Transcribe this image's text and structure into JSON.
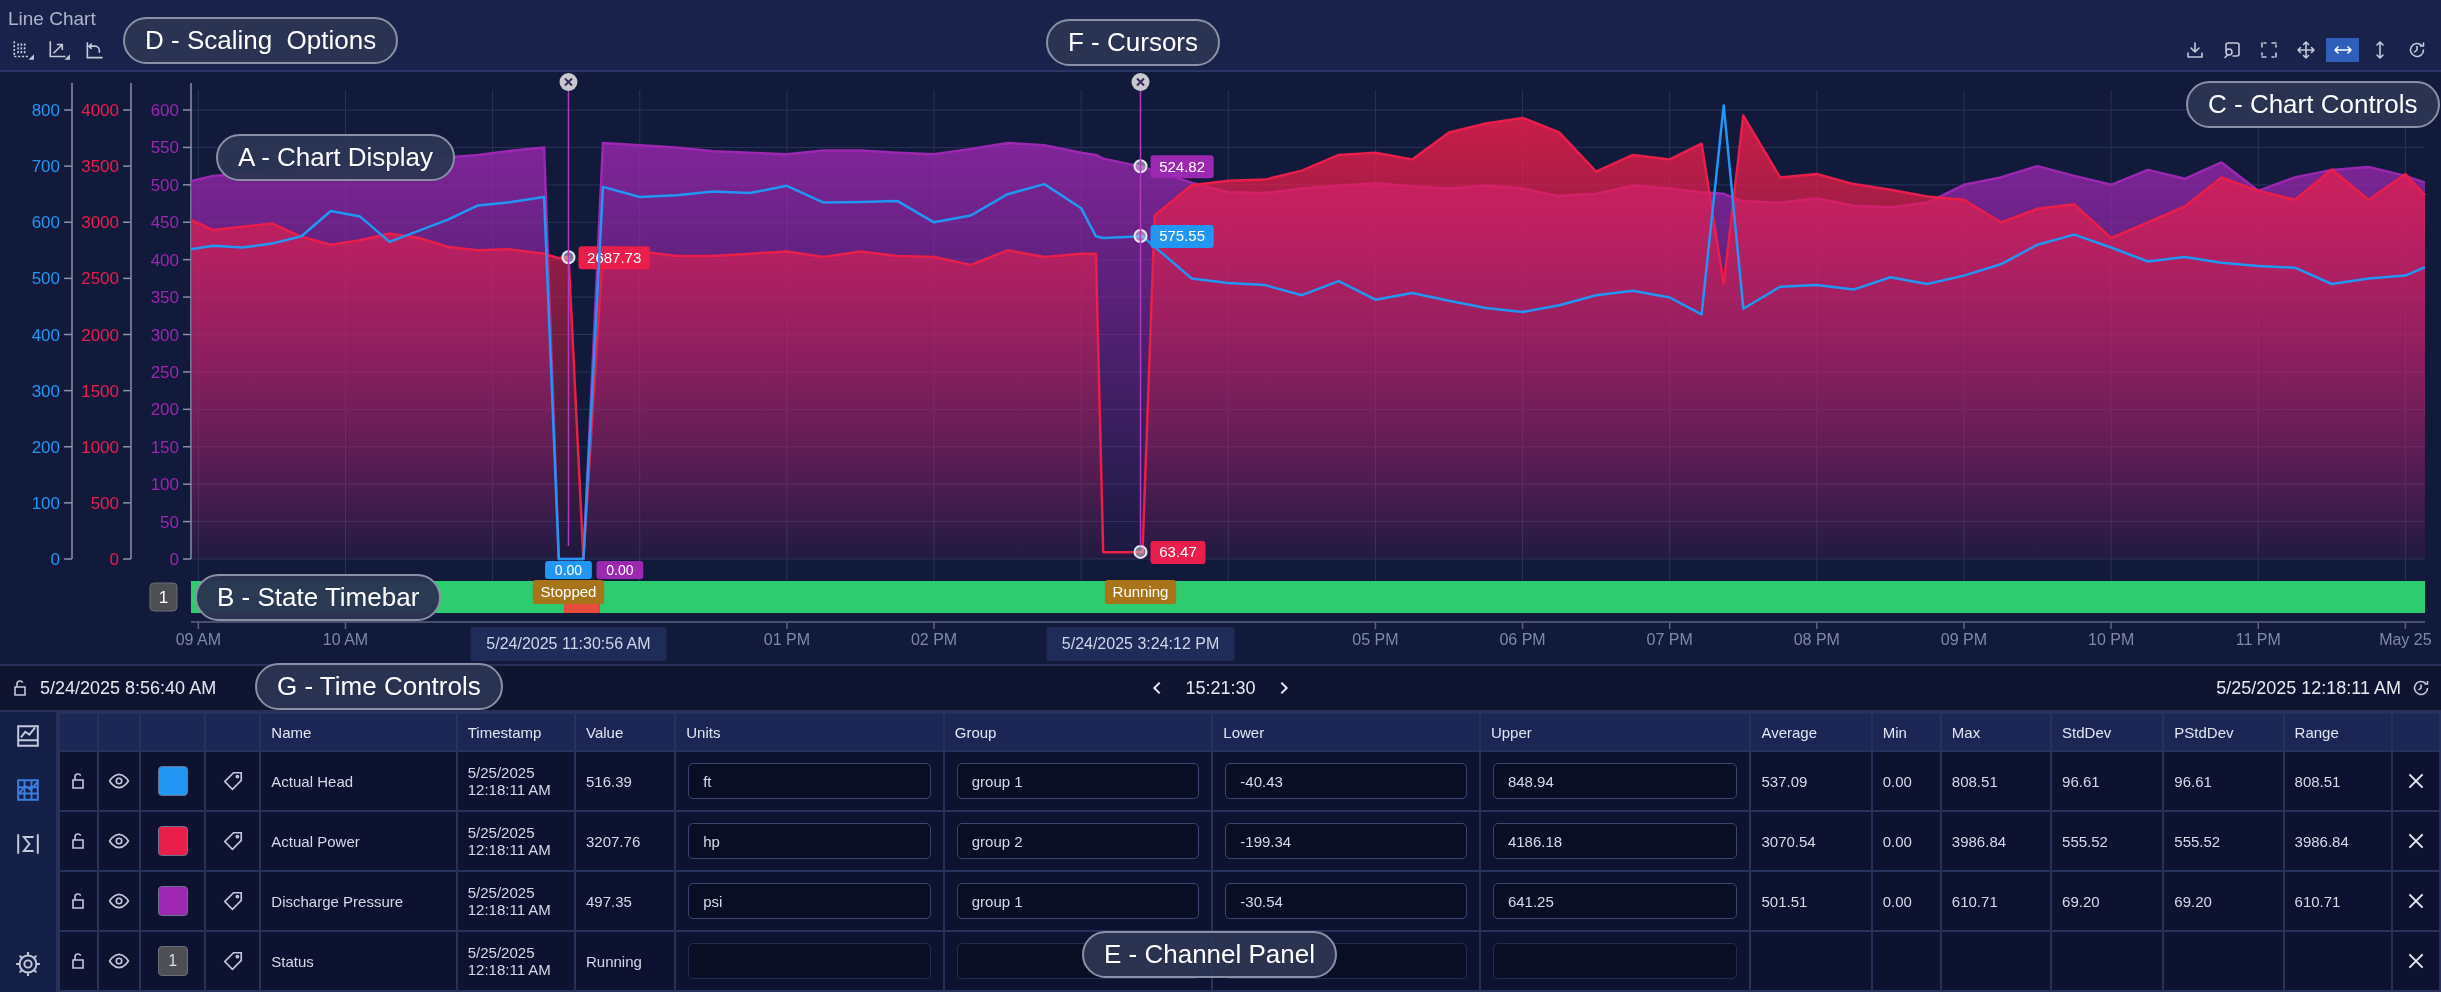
{
  "title": "Line Chart",
  "chart_controls": [
    {
      "selected": false
    },
    {
      "selected": false
    },
    {
      "selected": false
    },
    {
      "selected": false
    },
    {
      "selected": true
    },
    {
      "selected": false
    },
    {
      "selected": false
    }
  ],
  "chart": {
    "layers": [
      {
        "chart_data": {
          "type": "line",
          "x": [
            "2025-05-24T08:57",
            "2025-05-24T09:06",
            "2025-05-24T09:18",
            "2025-05-24T09:30",
            "2025-05-24T09:42",
            "2025-05-24T09:54",
            "2025-05-24T10:06",
            "2025-05-24T10:18",
            "2025-05-24T10:30",
            "2025-05-24T10:42",
            "2025-05-24T10:54",
            "2025-05-24T11:06",
            "2025-05-24T11:21",
            "2025-05-24T11:27",
            "2025-05-24T11:31",
            "2025-05-24T11:37",
            "2025-05-24T11:45",
            "2025-05-24T12:00",
            "2025-05-24T12:15",
            "2025-05-24T12:30",
            "2025-05-24T12:45",
            "2025-05-24T13:00",
            "2025-05-24T13:15",
            "2025-05-24T13:30",
            "2025-05-24T13:45",
            "2025-05-24T14:00",
            "2025-05-24T14:15",
            "2025-05-24T14:30",
            "2025-05-24T14:45",
            "2025-05-24T15:00",
            "2025-05-24T15:06",
            "2025-05-24T15:09",
            "2025-05-24T15:25",
            "2025-05-24T15:45",
            "2025-05-24T16:00",
            "2025-05-24T16:15",
            "2025-05-24T16:30",
            "2025-05-24T16:45",
            "2025-05-24T17:00",
            "2025-05-24T17:15",
            "2025-05-24T17:30",
            "2025-05-24T17:45",
            "2025-05-24T18:00",
            "2025-05-24T18:15",
            "2025-05-24T18:30",
            "2025-05-24T18:45",
            "2025-05-24T19:00",
            "2025-05-24T19:13",
            "2025-05-24T19:22",
            "2025-05-24T19:30",
            "2025-05-24T19:45",
            "2025-05-24T20:00",
            "2025-05-24T20:15",
            "2025-05-24T20:30",
            "2025-05-24T20:45",
            "2025-05-24T21:00",
            "2025-05-24T21:15",
            "2025-05-24T21:30",
            "2025-05-24T21:45",
            "2025-05-24T22:00",
            "2025-05-24T22:15",
            "2025-05-24T22:30",
            "2025-05-24T22:45",
            "2025-05-24T23:00",
            "2025-05-24T23:15",
            "2025-05-24T23:30",
            "2025-05-24T23:45",
            "2025-05-25T00:00",
            "2025-05-25T00:08"
          ],
          "xlim": [
            "2025-05-24T08:57",
            "2025-05-25T00:08"
          ],
          "xticks": [
            {
              "value": "2025-05-24T09:00",
              "label": "09 AM"
            },
            {
              "value": "2025-05-24T10:00",
              "label": "10 AM"
            },
            {
              "value": "2025-05-24T13:00",
              "label": "01 PM"
            },
            {
              "value": "2025-05-24T14:00",
              "label": "02 PM"
            },
            {
              "value": "2025-05-24T17:00",
              "label": "05 PM"
            },
            {
              "value": "2025-05-24T18:00",
              "label": "06 PM"
            },
            {
              "value": "2025-05-24T19:00",
              "label": "07 PM"
            },
            {
              "value": "2025-05-24T20:00",
              "label": "08 PM"
            },
            {
              "value": "2025-05-24T21:00",
              "label": "09 PM"
            },
            {
              "value": "2025-05-24T22:00",
              "label": "10 PM"
            },
            {
              "value": "2025-05-24T23:00",
              "label": "11 PM"
            },
            {
              "value": "2025-05-25T00:00",
              "label": "May 25"
            }
          ],
          "ylim": [
            0,
            848
          ],
          "yticks": [
            0,
            100,
            200,
            300,
            400,
            500,
            600,
            700,
            800
          ],
          "series": [
            {
              "color": "#2196f3",
              "values": [
                552,
                558,
                555,
                562,
                575,
                620,
                610,
                565,
                585,
                605,
                630,
                635,
                645,
                0,
                0,
                0,
                663,
                645,
                648,
                655,
                652,
                665,
                635,
                636,
                638,
                600,
                612,
                650,
                668,
                625,
                575,
                572,
                575,
                500,
                492,
                488,
                470,
                495,
                462,
                474,
                460,
                447,
                440,
                452,
                470,
                478,
                466,
                436,
                808,
                446,
                485,
                488,
                480,
                502,
                490,
                505,
                525,
                560,
                578,
                555,
                530,
                538,
                528,
                522,
                519,
                490,
                500,
                505,
                520
              ]
            }
          ],
          "annotations": [
            {
              "x": "2025-05-24T11:30:56",
              "y": 0,
              "text": "0.00"
            },
            {
              "x": "2025-05-24T15:24:12",
              "y": 575.55,
              "text": "575.55"
            }
          ]
        }
      },
      {
        "chart_data": {
          "type": "area",
          "x": [
            "2025-05-24T08:57",
            "2025-05-24T09:06",
            "2025-05-24T09:18",
            "2025-05-24T09:30",
            "2025-05-24T09:42",
            "2025-05-24T09:54",
            "2025-05-24T10:06",
            "2025-05-24T10:18",
            "2025-05-24T10:30",
            "2025-05-24T10:42",
            "2025-05-24T10:54",
            "2025-05-24T11:06",
            "2025-05-24T11:21",
            "2025-05-24T11:27",
            "2025-05-24T11:31",
            "2025-05-24T11:37",
            "2025-05-24T11:45",
            "2025-05-24T12:15",
            "2025-05-24T12:30",
            "2025-05-24T12:45",
            "2025-05-24T13:00",
            "2025-05-24T13:15",
            "2025-05-24T13:30",
            "2025-05-24T13:45",
            "2025-05-24T14:00",
            "2025-05-24T14:15",
            "2025-05-24T14:30",
            "2025-05-24T14:45",
            "2025-05-24T15:00",
            "2025-05-24T15:06",
            "2025-05-24T15:09",
            "2025-05-24T15:25",
            "2025-05-24T15:30",
            "2025-05-24T15:45",
            "2025-05-24T16:00",
            "2025-05-24T16:15",
            "2025-05-24T16:30",
            "2025-05-24T16:45",
            "2025-05-24T17:00",
            "2025-05-24T17:15",
            "2025-05-24T17:30",
            "2025-05-24T17:45",
            "2025-05-24T18:00",
            "2025-05-24T18:15",
            "2025-05-24T18:30",
            "2025-05-24T18:45",
            "2025-05-24T19:00",
            "2025-05-24T19:13",
            "2025-05-24T19:22",
            "2025-05-24T19:30",
            "2025-05-24T19:45",
            "2025-05-24T20:00",
            "2025-05-24T20:15",
            "2025-05-24T20:30",
            "2025-05-24T20:45",
            "2025-05-24T21:00",
            "2025-05-24T21:15",
            "2025-05-24T21:30",
            "2025-05-24T21:45",
            "2025-05-24T22:00",
            "2025-05-24T22:15",
            "2025-05-24T22:30",
            "2025-05-24T22:45",
            "2025-05-24T23:00",
            "2025-05-24T23:15",
            "2025-05-24T23:30",
            "2025-05-24T23:45",
            "2025-05-25T00:00",
            "2025-05-25T00:08"
          ],
          "xlim": [
            "2025-05-24T08:57",
            "2025-05-25T00:08"
          ],
          "ylim": [
            0,
            4240
          ],
          "yticks": [
            0,
            500,
            1000,
            1500,
            2000,
            2500,
            3000,
            3500,
            4000
          ],
          "series": [
            {
              "color": "#e91e4b",
              "values": [
                3020,
                2930,
                2960,
                2990,
                2870,
                2800,
                2840,
                2900,
                2860,
                2780,
                2750,
                2760,
                2720,
                2680,
                2690,
                0,
                2780,
                2700,
                2700,
                2720,
                2740,
                2690,
                2740,
                2700,
                2690,
                2620,
                2750,
                2690,
                2720,
                2720,
                60,
                60,
                3060,
                3330,
                3370,
                3380,
                3460,
                3600,
                3620,
                3560,
                3800,
                3880,
                3930,
                3800,
                3450,
                3600,
                3560,
                3700,
                2450,
                3950,
                3400,
                3430,
                3340,
                3290,
                3230,
                3200,
                3000,
                3120,
                3160,
                2860,
                3000,
                3140,
                3400,
                3280,
                3200,
                3470,
                3200,
                3430,
                3240
              ]
            }
          ],
          "annotations": [
            {
              "x": "2025-05-24T11:30:56",
              "y": 2687.73,
              "text": "2687.73"
            },
            {
              "x": "2025-05-24T15:24:12",
              "y": 63.47,
              "text": "63.47"
            }
          ]
        }
      },
      {
        "chart_data": {
          "type": "area",
          "x": [
            "2025-05-24T08:57",
            "2025-05-24T09:06",
            "2025-05-24T10:54",
            "2025-05-24T11:06",
            "2025-05-24T11:21",
            "2025-05-24T11:27",
            "2025-05-24T11:31",
            "2025-05-24T11:37",
            "2025-05-24T11:45",
            "2025-05-24T12:00",
            "2025-05-24T12:15",
            "2025-05-24T12:30",
            "2025-05-24T12:45",
            "2025-05-24T13:00",
            "2025-05-24T13:15",
            "2025-05-24T13:30",
            "2025-05-24T13:45",
            "2025-05-24T14:00",
            "2025-05-24T14:15",
            "2025-05-24T14:30",
            "2025-05-24T14:45",
            "2025-05-24T15:00",
            "2025-05-24T15:06",
            "2025-05-24T15:09",
            "2025-05-24T15:25",
            "2025-05-24T15:45",
            "2025-05-24T16:00",
            "2025-05-24T16:15",
            "2025-05-24T16:30",
            "2025-05-24T16:45",
            "2025-05-24T17:00",
            "2025-05-24T17:15",
            "2025-05-24T17:30",
            "2025-05-24T17:45",
            "2025-05-24T18:00",
            "2025-05-24T18:15",
            "2025-05-24T18:30",
            "2025-05-24T18:45",
            "2025-05-24T19:00",
            "2025-05-24T19:13",
            "2025-05-24T19:22",
            "2025-05-24T19:30",
            "2025-05-24T19:45",
            "2025-05-24T20:00",
            "2025-05-24T20:15",
            "2025-05-24T20:30",
            "2025-05-24T20:45",
            "2025-05-24T21:00",
            "2025-05-24T21:15",
            "2025-05-24T21:30",
            "2025-05-24T21:45",
            "2025-05-24T22:00",
            "2025-05-24T22:15",
            "2025-05-24T22:30",
            "2025-05-24T22:45",
            "2025-05-24T23:00",
            "2025-05-24T23:15",
            "2025-05-24T23:30",
            "2025-05-24T23:45",
            "2025-05-25T00:00",
            "2025-05-25T00:08"
          ],
          "xlim": [
            "2025-05-24T08:57",
            "2025-05-25T00:08"
          ],
          "ylim": [
            0,
            636
          ],
          "yticks": [
            0,
            50,
            100,
            150,
            200,
            250,
            300,
            350,
            400,
            450,
            500,
            550,
            600
          ],
          "series": [
            {
              "color": "#9c27b0",
              "values": [
                505,
                512,
                540,
                545,
                550,
                0,
                0,
                0,
                556,
                553,
                550,
                545,
                543,
                541,
                546,
                546,
                543,
                541,
                548,
                556,
                553,
                543,
                540,
                535,
                524,
                503,
                490,
                489,
                495,
                499,
                502,
                498,
                495,
                499,
                495,
                485,
                488,
                499,
                495,
                490,
                488,
                478,
                476,
                482,
                472,
                470,
                476,
                500,
                510,
                525,
                512,
                500,
                520,
                508,
                530,
                492,
                510,
                520,
                524,
                512,
                503
              ]
            }
          ],
          "annotations": [
            {
              "x": "2025-05-24T11:30:56",
              "y": 0,
              "text": "0.00"
            },
            {
              "x": "2025-05-24T15:24:12",
              "y": 524.82,
              "text": "524.82"
            }
          ]
        }
      }
    ],
    "cursors": [
      {
        "timestamp": "5/24/2025 11:30:56 AM",
        "state": "Stopped"
      },
      {
        "timestamp": "5/24/2025 3:24:12 PM",
        "state": "Running"
      }
    ],
    "state_bar": {
      "badge": "1",
      "segments": [
        {
          "color": "#2ecc71",
          "level": 0.167
        },
        {
          "color": "#e74c3c",
          "level": 0.016
        },
        {
          "color": "#2ecc71",
          "level": 0.817
        }
      ]
    }
  },
  "time_controls": {
    "start": "5/24/2025 8:56:40 AM",
    "duration": "15:21:30",
    "end": "5/25/2025 12:18:11 AM"
  },
  "channel_panel": {
    "side_tabs": [
      {
        "selected": false
      },
      {
        "selected": true
      },
      {
        "selected": false
      }
    ],
    "columns": [
      "Name",
      "Timestamp",
      "Value",
      "Units",
      "Group",
      "Lower",
      "Upper",
      "Average",
      "Min",
      "Max",
      "StdDev",
      "PStdDev",
      "Range"
    ],
    "rows": [
      {
        "kind": "channel",
        "color": "#2196f3",
        "name": "Actual Head",
        "timestamp": "5/25/2025 12:18:11 AM",
        "value": "516.39",
        "units": "ft",
        "group": "group 1",
        "lower": "-40.43",
        "upper": "848.94",
        "stats": [
          "537.09",
          "0.00",
          "808.51",
          "96.61",
          "96.61",
          "808.51"
        ]
      },
      {
        "kind": "channel",
        "color": "#e91e4b",
        "name": "Actual Power",
        "timestamp": "5/25/2025 12:18:11 AM",
        "value": "3207.76",
        "units": "hp",
        "group": "group 2",
        "lower": "-199.34",
        "upper": "4186.18",
        "stats": [
          "3070.54",
          "0.00",
          "3986.84",
          "555.52",
          "555.52",
          "3986.84"
        ]
      },
      {
        "kind": "channel",
        "color": "#9c27b0",
        "name": "Discharge Pressure",
        "timestamp": "5/25/2025 12:18:11 AM",
        "value": "497.35",
        "units": "psi",
        "group": "group 1",
        "lower": "-30.54",
        "upper": "641.25",
        "stats": [
          "501.51",
          "0.00",
          "610.71",
          "69.20",
          "69.20",
          "610.71"
        ]
      },
      {
        "kind": "state",
        "badge": "1",
        "name": "Status",
        "timestamp": "5/25/2025 12:18:11 AM",
        "value": "Running"
      }
    ]
  },
  "callouts": [
    {
      "text": "D - Scaling  Options"
    },
    {
      "text": "F - Cursors"
    },
    {
      "text": "C - Chart Controls"
    },
    {
      "text": "A - Chart Display"
    },
    {
      "text": "B - State Timebar"
    },
    {
      "text": "G - Time Controls"
    },
    {
      "text": "E - Channel Panel"
    }
  ]
}
